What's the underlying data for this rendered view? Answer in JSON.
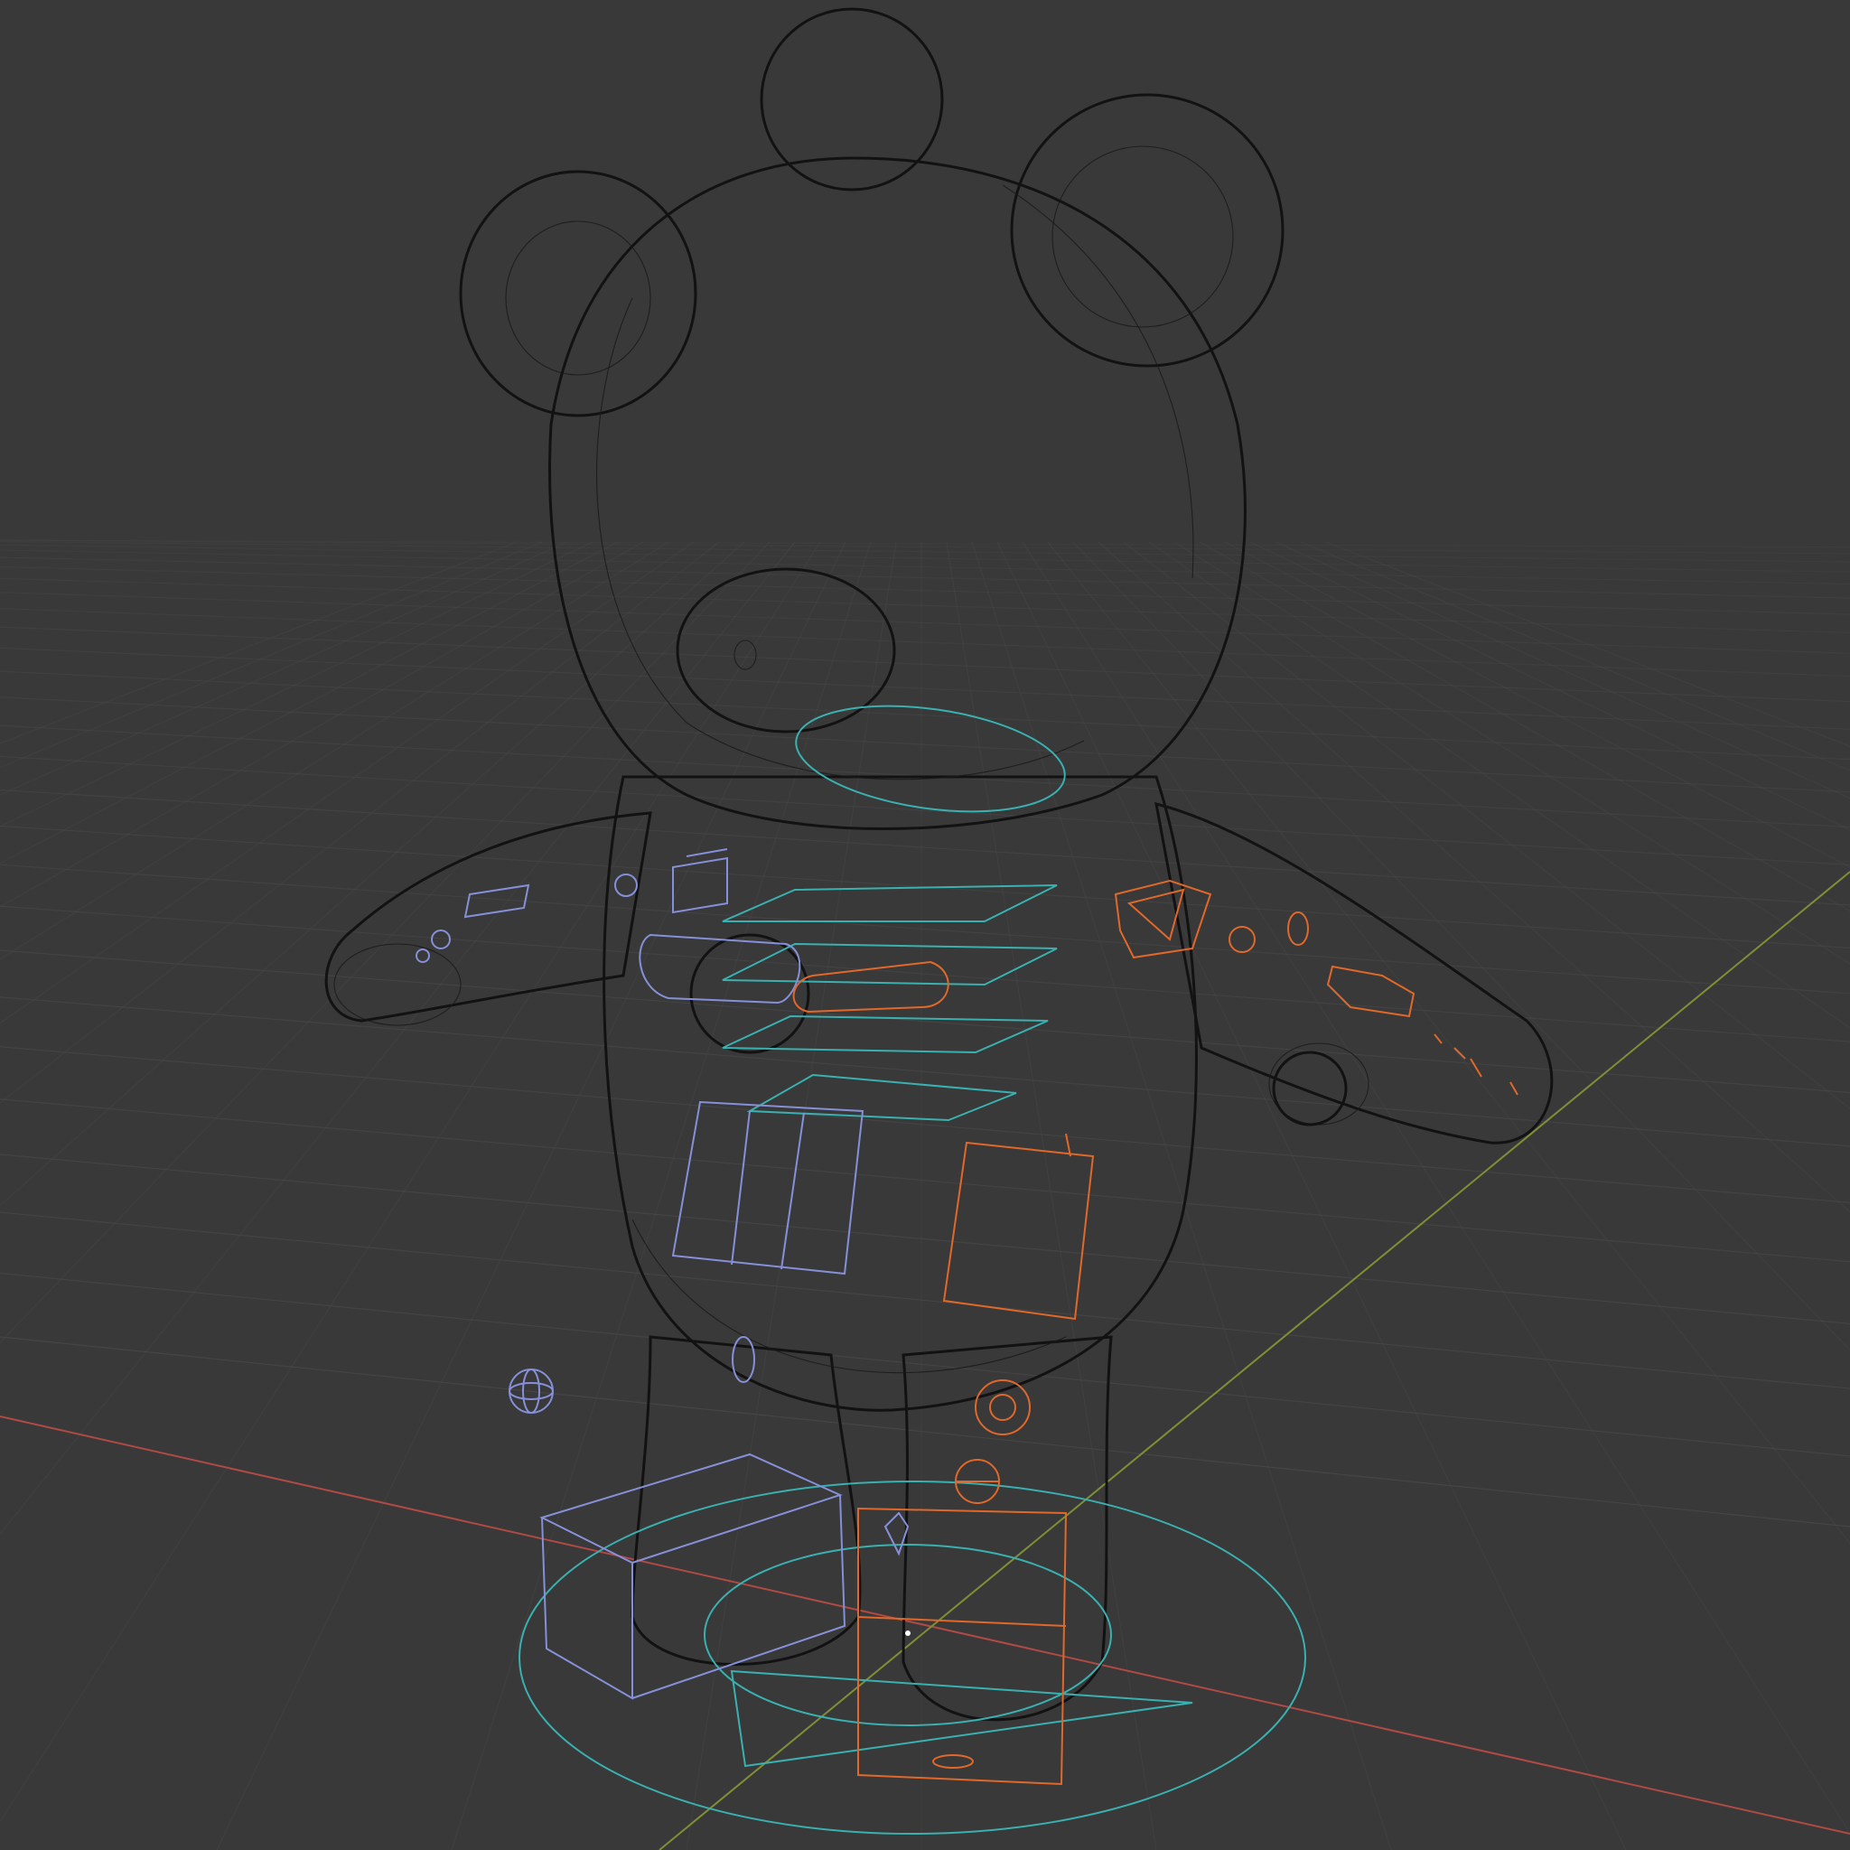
{
  "viewport": {
    "mode": "wireframe",
    "subject": "bear-character-rig",
    "grid_visible": true
  },
  "colors": {
    "background": "#393939",
    "grid": "#4a4a4a",
    "mesh_wire": "#1a1a1a",
    "axis_x": "#c0504a",
    "axis_y": "#8a9a3a",
    "ctrl_left": "#8590d8",
    "ctrl_right": "#e0682a",
    "ctrl_center": "#3ab0b0"
  }
}
